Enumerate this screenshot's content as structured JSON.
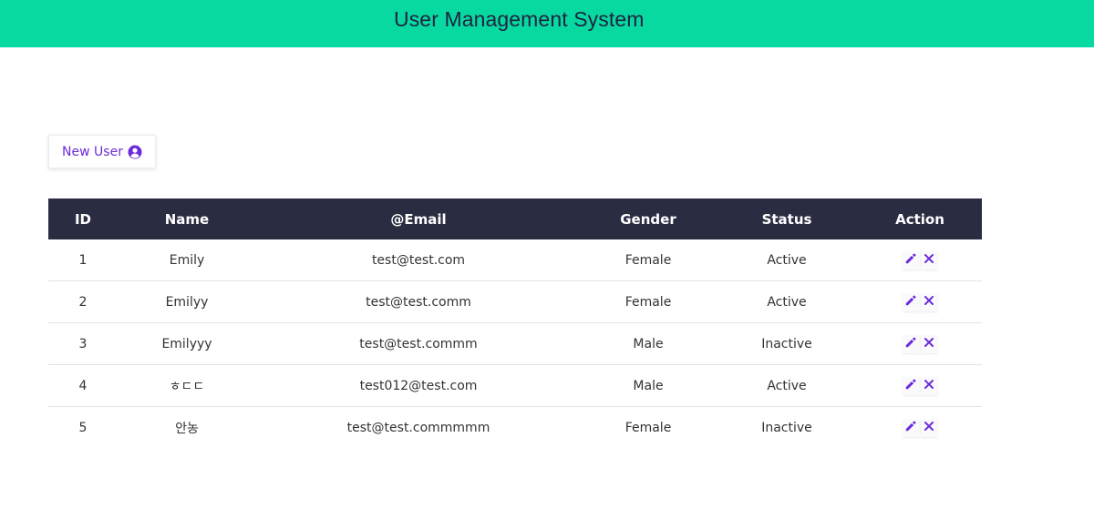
{
  "header": {
    "title": "User Management System",
    "background": "#07d9a1"
  },
  "toolbar": {
    "new_user_label": "New User",
    "new_user_icon": "user-circle-icon",
    "accent": "#6c2bd9"
  },
  "table": {
    "columns": [
      "ID",
      "Name",
      "@Email",
      "Gender",
      "Status",
      "Action"
    ],
    "rows": [
      {
        "id": "1",
        "name": "Emily",
        "email": "test@test.com",
        "gender": "Female",
        "status": "Active"
      },
      {
        "id": "2",
        "name": "Emilyy",
        "email": "test@test.comm",
        "gender": "Female",
        "status": "Active"
      },
      {
        "id": "3",
        "name": "Emilyyy",
        "email": "test@test.commm",
        "gender": "Male",
        "status": "Inactive"
      },
      {
        "id": "4",
        "name": "ㅎㄷㄷ",
        "email": "test012@test.com",
        "gender": "Male",
        "status": "Active"
      },
      {
        "id": "5",
        "name": "안농",
        "email": "test@test.commmmm",
        "gender": "Female",
        "status": "Inactive"
      }
    ],
    "action_icons": [
      "pencil-icon",
      "close-icon"
    ],
    "header_background": "#2a2d42",
    "icon_color": "#6c2bd9"
  }
}
